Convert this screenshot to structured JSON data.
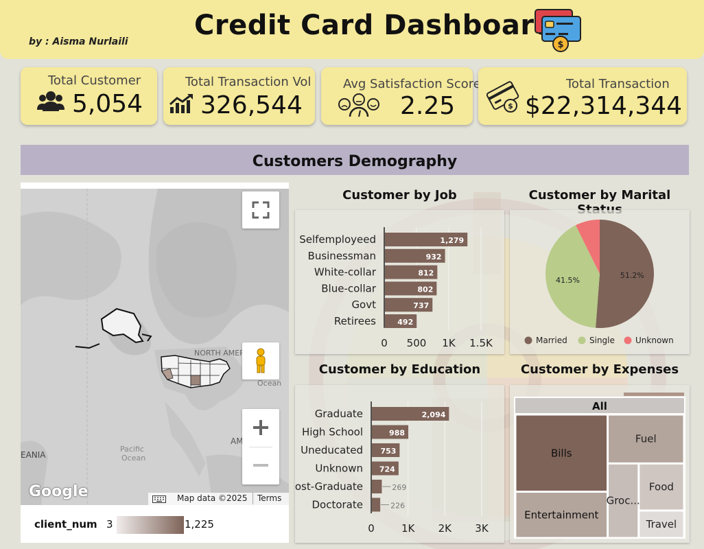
{
  "header": {
    "author": "by : Aisma Nurlaili",
    "title": "Credit Card Dashboard"
  },
  "kpis": {
    "customer": {
      "label": "Total Customer",
      "value": "5,054"
    },
    "volume": {
      "label": "Total Transaction Vol",
      "value": "326,544"
    },
    "satisfaction": {
      "label": "Avg Satisfaction Score",
      "value": "2.25"
    },
    "transaction": {
      "label": "Total Transaction",
      "value": "$22,314,344"
    }
  },
  "section": {
    "title": "Customers Demography"
  },
  "map": {
    "labels": {
      "north_america": "NORTH AMERICA",
      "ocean": "Ocean",
      "pacific": "Pacific Ocean",
      "asia": "EANIA",
      "am": "AM"
    },
    "attribution": "Map data ©2025",
    "terms": "Terms",
    "google": "Google",
    "legend": {
      "field": "client_num",
      "min": "3",
      "max": "1,225"
    }
  },
  "colors": {
    "bar": "#7e6358",
    "married": "#7e6358",
    "single": "#b9cc8a",
    "unknown": "#ef7375",
    "header": "#f5e99b",
    "section": "#b9b1c6"
  },
  "charts": {
    "job": {
      "title": "Customer by Job"
    },
    "marital": {
      "title": "Customer by Marital Status"
    },
    "education": {
      "title": "Customer by Education"
    },
    "expenses": {
      "title": "Customer by Expenses",
      "root": "All"
    }
  },
  "chart_data": [
    {
      "type": "bar",
      "orientation": "horizontal",
      "title": "Customer by Job",
      "categories": [
        "Selfemployeed",
        "Businessman",
        "White-collar",
        "Blue-collar",
        "Govt",
        "Retirees"
      ],
      "values": [
        1279,
        932,
        812,
        802,
        737,
        492
      ],
      "value_labels": [
        "1,279",
        "932",
        "812",
        "802",
        "737",
        "492"
      ],
      "xlim": [
        0,
        1500
      ],
      "xticks": [
        "0",
        "500",
        "1K",
        "1.5K"
      ]
    },
    {
      "type": "pie",
      "title": "Customer by Marital Status",
      "labels": [
        "Married",
        "Single",
        "Unknown"
      ],
      "values": [
        51.2,
        41.5,
        7.3
      ],
      "slice_labels": [
        "51.2%",
        "41.5%",
        ""
      ],
      "legend": "bottom"
    },
    {
      "type": "bar",
      "orientation": "horizontal",
      "title": "Customer by Education",
      "categories": [
        "Graduate",
        "High School",
        "Uneducated",
        "Unknown",
        "Post-Graduate",
        "Doctorate"
      ],
      "values": [
        2094,
        988,
        753,
        724,
        269,
        226
      ],
      "value_labels": [
        "2,094",
        "988",
        "753",
        "724",
        "269",
        "226"
      ],
      "xlim": [
        0,
        3000
      ],
      "xticks": [
        "0",
        "1K",
        "2K",
        "3K"
      ]
    },
    {
      "type": "treemap",
      "title": "Customer by Expenses",
      "labels": [
        "Bills",
        "Entertainment",
        "Fuel",
        "Groc...",
        "Food",
        "Travel"
      ],
      "values": [
        40,
        24,
        21,
        13,
        12,
        7
      ]
    }
  ]
}
